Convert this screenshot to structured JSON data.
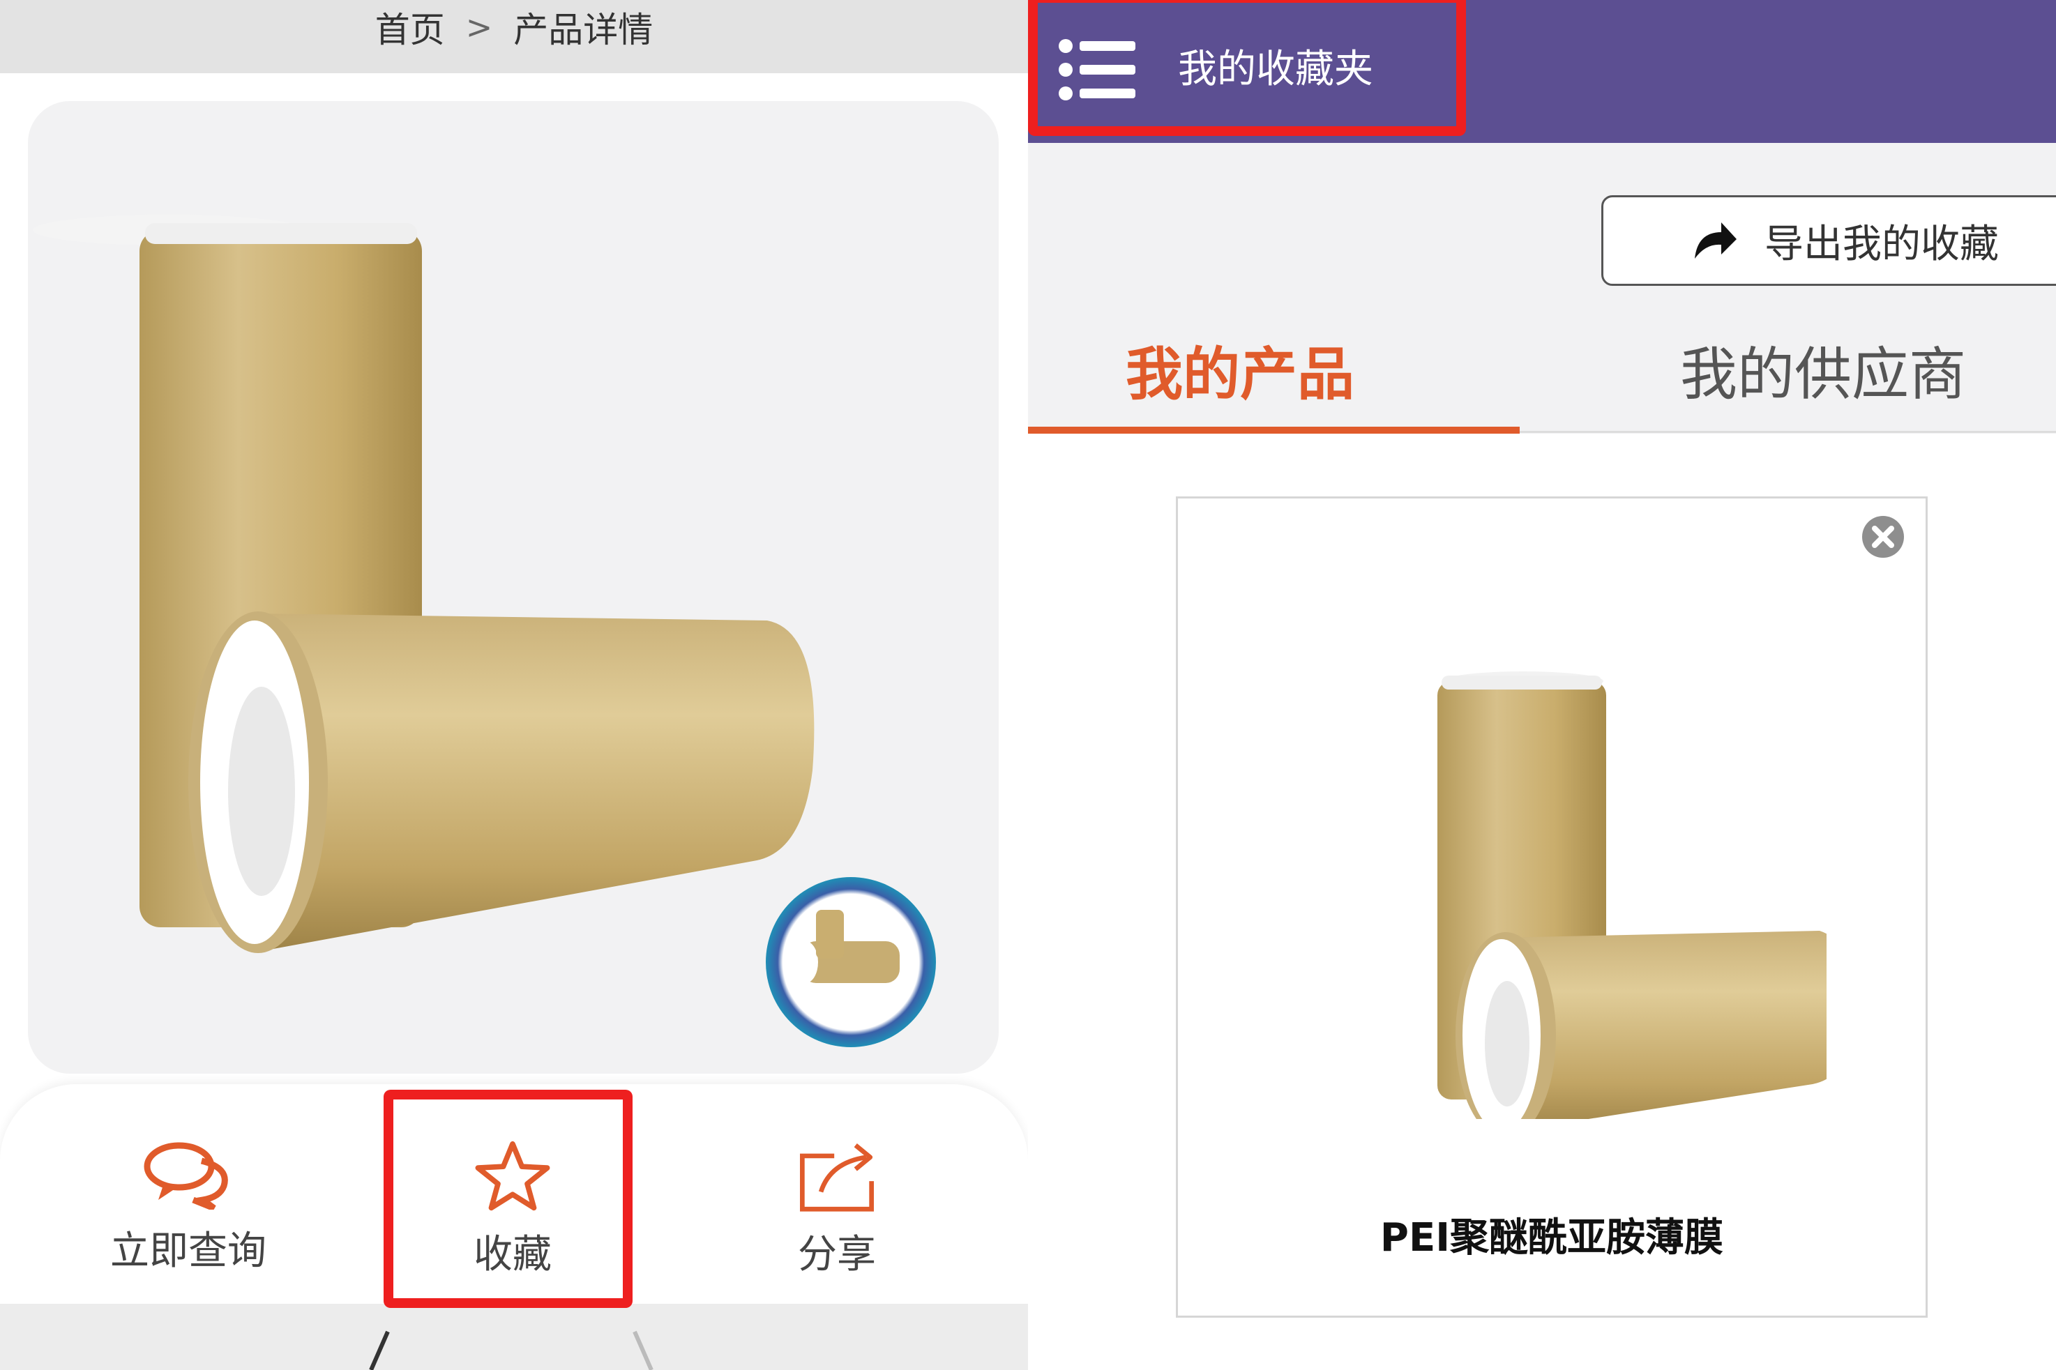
{
  "left": {
    "breadcrumb": {
      "home": "首页",
      "separator": ">",
      "current": "产品详情"
    },
    "actions": {
      "inquire_label": "立即查询",
      "favorite_label": "收藏",
      "share_label": "分享"
    },
    "accent_color": "#e05b2b",
    "highlight_color": "#ee1f1f"
  },
  "right": {
    "header": {
      "title": "我的收藏夹",
      "background": "#5c4f92",
      "menu_icon": "list-menu-icon"
    },
    "export_button": {
      "label": "导出我的收藏",
      "icon": "share-arrow-icon"
    },
    "tabs": [
      {
        "label": "我的产品",
        "active": true
      },
      {
        "label": "我的供应商",
        "active": false
      }
    ],
    "card": {
      "title": "PEI聚醚酰亚胺薄膜",
      "remove_icon": "close-circle-icon"
    }
  }
}
